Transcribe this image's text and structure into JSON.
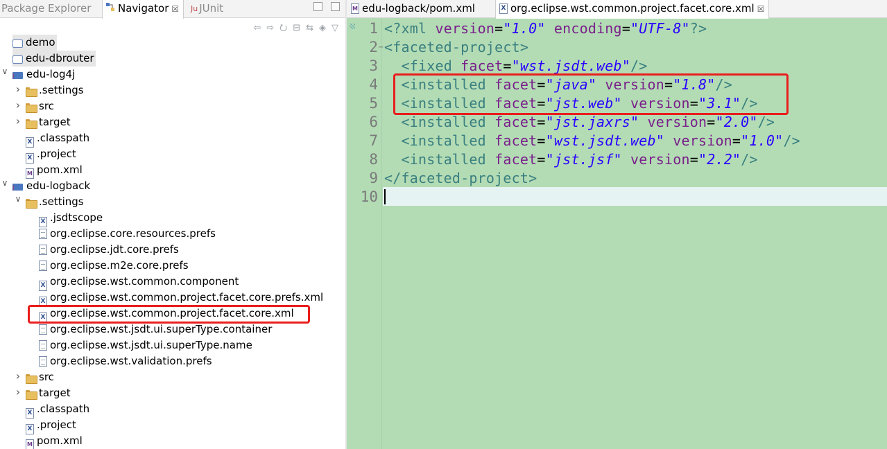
{
  "left_panel": {
    "tabs": [
      {
        "label": "Package Explorer",
        "active": false,
        "icon": "package-explorer-icon"
      },
      {
        "label": "Navigator",
        "active": true,
        "icon": "navigator-icon"
      },
      {
        "label": "JUnit",
        "active": false,
        "icon": "junit-icon"
      }
    ],
    "tab_close_glyph": "☒",
    "toolbar": [
      "back-icon",
      "forward-icon",
      "up-icon",
      "collapse-all-icon",
      "link-with-editor-icon",
      "filters-icon",
      "view-menu-icon"
    ],
    "tree": [
      {
        "label": "demo",
        "icon": "closed-project-icon",
        "indent": 0,
        "expander": "none",
        "selected": true
      },
      {
        "label": "edu-dbrouter",
        "icon": "closed-project-icon",
        "indent": 0,
        "expander": "none",
        "selected": true
      },
      {
        "label": "edu-log4j",
        "icon": "maven-project-icon",
        "indent": 0,
        "expander": "expanded"
      },
      {
        "label": ".settings",
        "icon": "folder-icon",
        "indent": 1,
        "expander": "collapsed"
      },
      {
        "label": "src",
        "icon": "folder-icon",
        "indent": 1,
        "expander": "collapsed"
      },
      {
        "label": "target",
        "icon": "folder-icon",
        "indent": 1,
        "expander": "collapsed"
      },
      {
        "label": ".classpath",
        "icon": "xml-file-icon",
        "indent": 1,
        "expander": "none"
      },
      {
        "label": ".project",
        "icon": "xml-file-icon",
        "indent": 1,
        "expander": "none"
      },
      {
        "label": "pom.xml",
        "icon": "maven-file-icon",
        "indent": 1,
        "expander": "none"
      },
      {
        "label": "edu-logback",
        "icon": "maven-project-icon",
        "indent": 0,
        "expander": "expanded"
      },
      {
        "label": ".settings",
        "icon": "folder-icon",
        "indent": 1,
        "expander": "expanded"
      },
      {
        "label": ".jsdtscope",
        "icon": "xml-file-icon",
        "indent": 2,
        "expander": "none"
      },
      {
        "label": "org.eclipse.core.resources.prefs",
        "icon": "text-file-icon",
        "indent": 2,
        "expander": "none"
      },
      {
        "label": "org.eclipse.jdt.core.prefs",
        "icon": "text-file-icon",
        "indent": 2,
        "expander": "none"
      },
      {
        "label": "org.eclipse.m2e.core.prefs",
        "icon": "text-file-icon",
        "indent": 2,
        "expander": "none"
      },
      {
        "label": "org.eclipse.wst.common.component",
        "icon": "xml-file-icon",
        "indent": 2,
        "expander": "none"
      },
      {
        "label": "org.eclipse.wst.common.project.facet.core.prefs.xml",
        "icon": "xml-file-icon",
        "indent": 2,
        "expander": "none"
      },
      {
        "label": "org.eclipse.wst.common.project.facet.core.xml",
        "icon": "xml-file-icon",
        "indent": 2,
        "expander": "none",
        "highlighted": true
      },
      {
        "label": "org.eclipse.wst.jsdt.ui.superType.container",
        "icon": "text-file-icon",
        "indent": 2,
        "expander": "none"
      },
      {
        "label": "org.eclipse.wst.jsdt.ui.superType.name",
        "icon": "text-file-icon",
        "indent": 2,
        "expander": "none"
      },
      {
        "label": "org.eclipse.wst.validation.prefs",
        "icon": "text-file-icon",
        "indent": 2,
        "expander": "none"
      },
      {
        "label": "src",
        "icon": "folder-icon",
        "indent": 1,
        "expander": "collapsed"
      },
      {
        "label": "target",
        "icon": "folder-icon",
        "indent": 1,
        "expander": "collapsed"
      },
      {
        "label": ".classpath",
        "icon": "xml-file-icon",
        "indent": 1,
        "expander": "none"
      },
      {
        "label": ".project",
        "icon": "xml-file-icon",
        "indent": 1,
        "expander": "none"
      },
      {
        "label": "pom.xml",
        "icon": "maven-file-icon",
        "indent": 1,
        "expander": "none"
      }
    ]
  },
  "editor": {
    "tabs": [
      {
        "label": "edu-logback/pom.xml",
        "active": false,
        "icon": "maven-file-icon"
      },
      {
        "label": "org.eclipse.wst.common.project.facet.core.xml",
        "active": true,
        "icon": "xml-file-icon"
      }
    ],
    "tab_close_glyph": "☒",
    "lines": [
      {
        "n": "1",
        "fold": "",
        "tokens": [
          [
            "t",
            "<?xml "
          ],
          [
            "a",
            "version"
          ],
          [
            "p",
            "="
          ],
          [
            "v",
            "\"1.0\""
          ],
          [
            "p",
            " "
          ],
          [
            "a",
            "encoding"
          ],
          [
            "p",
            "="
          ],
          [
            "v",
            "\"UTF-8\""
          ],
          [
            "t",
            "?>"
          ]
        ]
      },
      {
        "n": "2",
        "fold": "−",
        "tokens": [
          [
            "t",
            "<faceted-project>"
          ]
        ]
      },
      {
        "n": "3",
        "fold": "",
        "tokens": [
          [
            "p",
            "  "
          ],
          [
            "t",
            "<fixed "
          ],
          [
            "a",
            "facet"
          ],
          [
            "p",
            "="
          ],
          [
            "v",
            "\"wst.jsdt.web\""
          ],
          [
            "t",
            "/>"
          ]
        ]
      },
      {
        "n": "4",
        "fold": "",
        "tokens": [
          [
            "p",
            "  "
          ],
          [
            "t",
            "<installed "
          ],
          [
            "a",
            "facet"
          ],
          [
            "p",
            "="
          ],
          [
            "v",
            "\"java\""
          ],
          [
            "p",
            " "
          ],
          [
            "a",
            "version"
          ],
          [
            "p",
            "="
          ],
          [
            "v",
            "\"1.8\""
          ],
          [
            "t",
            "/>"
          ]
        ]
      },
      {
        "n": "5",
        "fold": "",
        "tokens": [
          [
            "p",
            "  "
          ],
          [
            "t",
            "<installed "
          ],
          [
            "a",
            "facet"
          ],
          [
            "p",
            "="
          ],
          [
            "v",
            "\"jst.web\""
          ],
          [
            "p",
            " "
          ],
          [
            "a",
            "version"
          ],
          [
            "p",
            "="
          ],
          [
            "v",
            "\"3.1\""
          ],
          [
            "t",
            "/>"
          ]
        ]
      },
      {
        "n": "6",
        "fold": "",
        "tokens": [
          [
            "p",
            "  "
          ],
          [
            "t",
            "<installed "
          ],
          [
            "a",
            "facet"
          ],
          [
            "p",
            "="
          ],
          [
            "v",
            "\"jst.jaxrs\""
          ],
          [
            "p",
            " "
          ],
          [
            "a",
            "version"
          ],
          [
            "p",
            "="
          ],
          [
            "v",
            "\"2.0\""
          ],
          [
            "t",
            "/>"
          ]
        ]
      },
      {
        "n": "7",
        "fold": "",
        "tokens": [
          [
            "p",
            "  "
          ],
          [
            "t",
            "<installed "
          ],
          [
            "a",
            "facet"
          ],
          [
            "p",
            "="
          ],
          [
            "v",
            "\"wst.jsdt.web\""
          ],
          [
            "p",
            " "
          ],
          [
            "a",
            "version"
          ],
          [
            "p",
            "="
          ],
          [
            "v",
            "\"1.0\""
          ],
          [
            "t",
            "/>"
          ]
        ]
      },
      {
        "n": "8",
        "fold": "",
        "tokens": [
          [
            "p",
            "  "
          ],
          [
            "t",
            "<installed "
          ],
          [
            "a",
            "facet"
          ],
          [
            "p",
            "="
          ],
          [
            "v",
            "\"jst.jsf\""
          ],
          [
            "p",
            " "
          ],
          [
            "a",
            "version"
          ],
          [
            "p",
            "="
          ],
          [
            "v",
            "\"2.2\""
          ],
          [
            "t",
            "/>"
          ]
        ]
      },
      {
        "n": "9",
        "fold": "",
        "tokens": [
          [
            "t",
            "</faceted-project>"
          ]
        ]
      },
      {
        "n": "10",
        "fold": "",
        "tokens": []
      }
    ],
    "current_line": "10"
  },
  "colors": {
    "editor_bg": "#b3dcb5",
    "current_line": "#e6f3f3",
    "tag": "#3a7f7f",
    "attribute": "#7a1f8a",
    "value": "#2a00ff",
    "annotation_red": "#ea1d1d",
    "selection_gray": "#e6e6e6"
  }
}
